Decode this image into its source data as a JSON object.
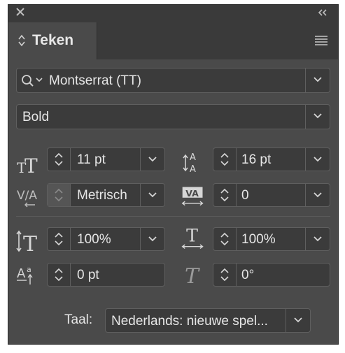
{
  "panel": {
    "tab_label": "Teken",
    "font_family": "Montserrat (TT)",
    "font_style": "Bold",
    "font_size": "11 pt",
    "leading": "16 pt",
    "kerning": "Metrisch",
    "tracking": "0",
    "vertical_scale": "100%",
    "horizontal_scale": "100%",
    "baseline_shift": "0 pt",
    "skew": "0°",
    "language_label": "Taal:",
    "language_value": "Nederlands: nieuwe spel..."
  },
  "colors": {
    "panel_bg": "#4a4a4a",
    "titlebar_bg": "#3a3a3a",
    "field_bg": "#3b3b3b",
    "text": "#e6e6e6"
  },
  "icons": [
    "close-icon",
    "collapse-icon",
    "panel-menu-icon",
    "search-icon",
    "chevron-down-icon",
    "stepper-icon"
  ]
}
